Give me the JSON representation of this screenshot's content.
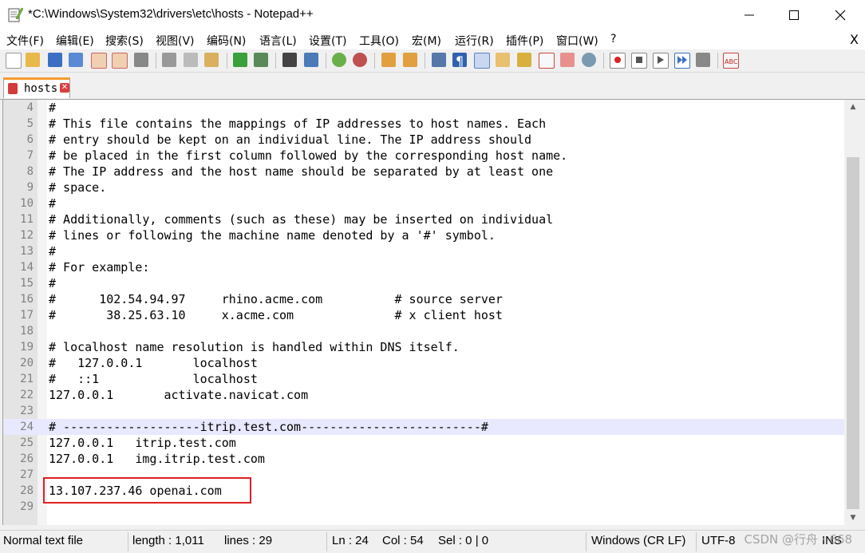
{
  "window": {
    "title": "*C:\\Windows\\System32\\drivers\\etc\\hosts - Notepad++",
    "minimize": "—",
    "maximize": "☐",
    "close": "✕"
  },
  "menu": {
    "items": [
      "文件(F)",
      "编辑(E)",
      "搜索(S)",
      "视图(V)",
      "编码(N)",
      "语言(L)",
      "设置(T)",
      "工具(O)",
      "宏(M)",
      "运行(R)",
      "插件(P)",
      "窗口(W)",
      "?"
    ],
    "close": "X"
  },
  "tab": {
    "label": "hosts",
    "close": "✕"
  },
  "editor": {
    "lines": [
      {
        "n": "4",
        "text": "#"
      },
      {
        "n": "5",
        "text": "# This file contains the mappings of IP addresses to host names. Each"
      },
      {
        "n": "6",
        "text": "# entry should be kept on an individual line. The IP address should"
      },
      {
        "n": "7",
        "text": "# be placed in the first column followed by the corresponding host name."
      },
      {
        "n": "8",
        "text": "# The IP address and the host name should be separated by at least one"
      },
      {
        "n": "9",
        "text": "# space."
      },
      {
        "n": "10",
        "text": "#"
      },
      {
        "n": "11",
        "text": "# Additionally, comments (such as these) may be inserted on individual"
      },
      {
        "n": "12",
        "text": "# lines or following the machine name denoted by a '#' symbol."
      },
      {
        "n": "13",
        "text": "#"
      },
      {
        "n": "14",
        "text": "# For example:"
      },
      {
        "n": "15",
        "text": "#"
      },
      {
        "n": "16",
        "text": "#      102.54.94.97     rhino.acme.com          # source server"
      },
      {
        "n": "17",
        "text": "#       38.25.63.10     x.acme.com              # x client host"
      },
      {
        "n": "18",
        "text": ""
      },
      {
        "n": "19",
        "text": "# localhost name resolution is handled within DNS itself."
      },
      {
        "n": "20",
        "text": "#   127.0.0.1       localhost"
      },
      {
        "n": "21",
        "text": "#   ::1             localhost"
      },
      {
        "n": "22",
        "text": "127.0.0.1       activate.navicat.com"
      },
      {
        "n": "23",
        "text": ""
      },
      {
        "n": "24",
        "text": "# -------------------itrip.test.com-------------------------#"
      },
      {
        "n": "25",
        "text": "127.0.0.1   itrip.test.com"
      },
      {
        "n": "26",
        "text": "127.0.0.1   img.itrip.test.com"
      },
      {
        "n": "27",
        "text": ""
      },
      {
        "n": "28",
        "text": "13.107.237.46 openai.com"
      },
      {
        "n": "29",
        "text": ""
      }
    ]
  },
  "status": {
    "file_type": "Normal text file",
    "length": "length : 1,011",
    "lines": "lines : 29",
    "ln": "Ln : 24",
    "col": "Col : 54",
    "sel": "Sel : 0 | 0",
    "eol": "Windows (CR LF)",
    "encoding": "UTF-8",
    "mode": "INS",
    "watermark": "CSDN @行舟 · 668"
  },
  "colors": {
    "current_line": "#e8e8ff",
    "highlight_box": "#e02020",
    "tab_accent": "#f89a2e"
  }
}
